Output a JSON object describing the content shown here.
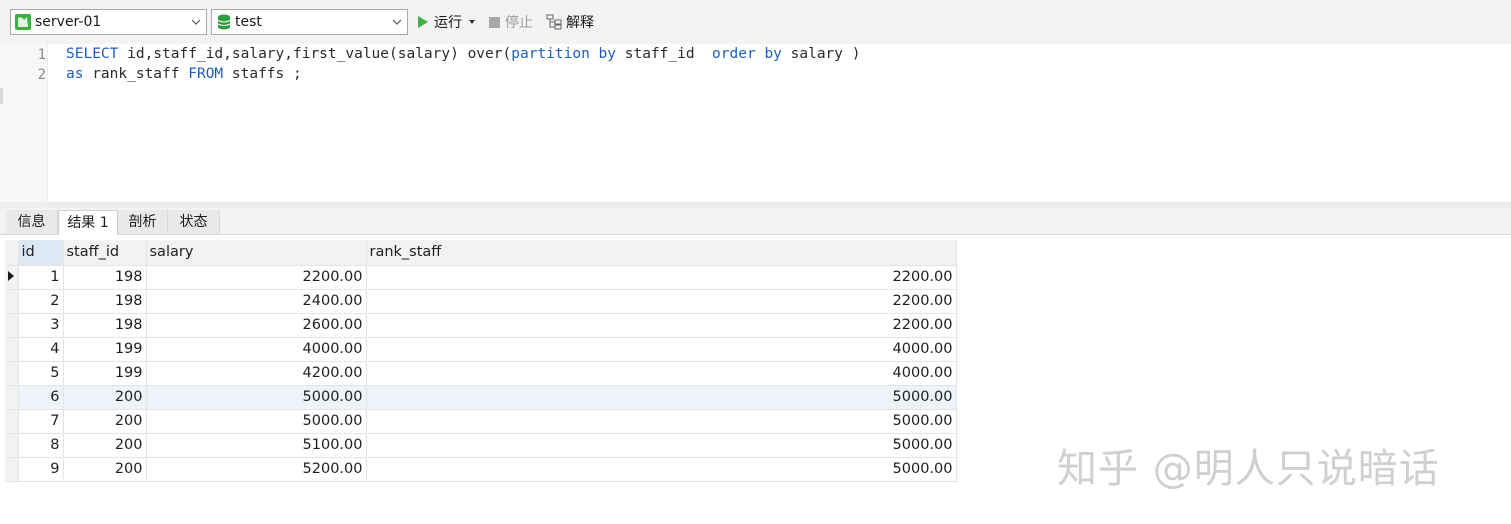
{
  "toolbar": {
    "connection": "server-01",
    "database": "test",
    "run_label": "运行",
    "stop_label": "停止",
    "explain_label": "解释"
  },
  "editor": {
    "line_numbers": [
      "1",
      "2"
    ]
  },
  "result_tabs": [
    "信息",
    "结果 1",
    "剖析",
    "状态"
  ],
  "grid": {
    "columns": [
      "id",
      "staff_id",
      "salary",
      "rank_staff"
    ],
    "rows": [
      [
        "1",
        "198",
        "2200.00",
        "2200.00"
      ],
      [
        "2",
        "198",
        "2400.00",
        "2200.00"
      ],
      [
        "3",
        "198",
        "2600.00",
        "2200.00"
      ],
      [
        "4",
        "199",
        "4000.00",
        "4000.00"
      ],
      [
        "5",
        "199",
        "4200.00",
        "4000.00"
      ],
      [
        "6",
        "200",
        "5000.00",
        "5000.00"
      ],
      [
        "7",
        "200",
        "5000.00",
        "5000.00"
      ],
      [
        "8",
        "200",
        "5100.00",
        "5000.00"
      ],
      [
        "9",
        "200",
        "5200.00",
        "5000.00"
      ]
    ]
  },
  "watermark": "知乎 @明人只说暗话",
  "colors": {
    "keyword": "#1c5fbf",
    "run_icon": "#3cb043",
    "db_icon": "#2e9e3e",
    "selected_header": "#dde8f6",
    "highlight_row": "#eef3fa"
  },
  "icons": {
    "connection": "navicat-connection-icon",
    "database": "database-icon",
    "run": "play-icon",
    "stop": "stop-icon",
    "explain": "explain-icon",
    "current_row": "row-pointer-icon"
  }
}
